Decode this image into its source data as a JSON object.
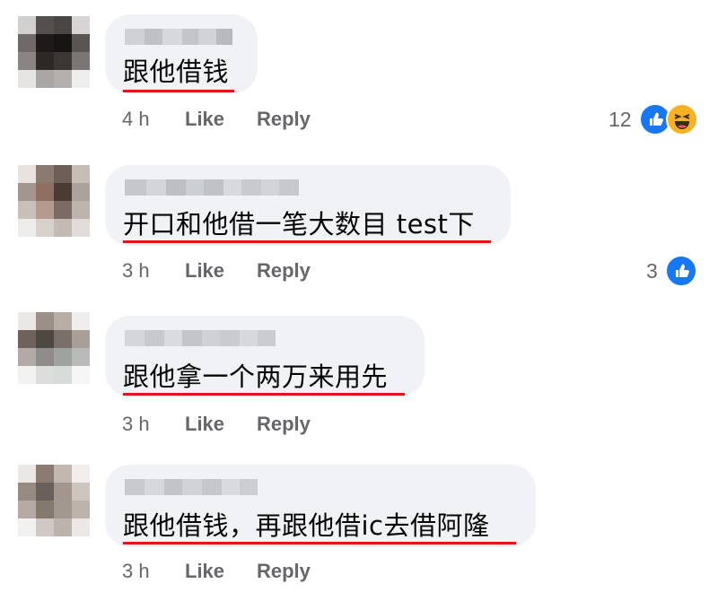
{
  "comments": [
    {
      "text": "跟他借钱",
      "time": "4 h",
      "like_label": "Like",
      "reply_label": "Reply",
      "reaction_count": "12",
      "reactions": [
        "like-icon",
        "haha-icon"
      ]
    },
    {
      "text": "开口和他借一笔大数目 test下",
      "time": "3 h",
      "like_label": "Like",
      "reply_label": "Reply",
      "reaction_count": "3",
      "reactions": [
        "like-icon"
      ]
    },
    {
      "text": "跟他拿一个两万来用先",
      "time": "3 h",
      "like_label": "Like",
      "reply_label": "Reply"
    },
    {
      "text": "跟他借钱，再跟他借ic去借阿隆",
      "time": "3 h",
      "like_label": "Like",
      "reply_label": "Reply"
    }
  ],
  "colors": {
    "bubble": "#f0f2f5",
    "underline": "#e0161a",
    "meta_text": "#65676b",
    "like_blue": "#1877f2",
    "haha_yellow": "#f7b125"
  }
}
